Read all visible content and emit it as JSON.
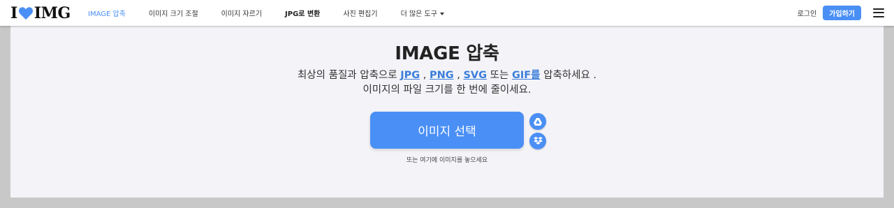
{
  "logo": {
    "left": "I",
    "right": "IMG"
  },
  "nav": {
    "items": [
      {
        "label": "IMAGE 압축"
      },
      {
        "label": "이미지 크기 조절"
      },
      {
        "label": "이미지 자르기"
      },
      {
        "label": "JPG로 변환"
      },
      {
        "label": "사진 편집기"
      },
      {
        "label": "더 많은 도구"
      }
    ],
    "login": "로그인",
    "signup": "가입하기"
  },
  "hero": {
    "title": "IMAGE 압축",
    "desc_prefix": "최상의 품질과 압축으로 ",
    "formats": [
      "JPG",
      "PNG",
      "SVG",
      "GIF를"
    ],
    "sep1": " , ",
    "sep2": " , ",
    "sep3": " 또는 ",
    "desc_suffix": " 압축하세요 .",
    "desc_line2": "이미지의 파일 크기를 한 번에 줄이세요.",
    "upload_label": "이미지 선택",
    "hint": "또는 여기에 이미지를 놓으세요"
  },
  "icons": {
    "cloud_top": "google-drive-icon",
    "cloud_bottom": "dropbox-icon"
  },
  "colors": {
    "accent": "#4a8ff5",
    "link": "#3b7ed9"
  }
}
